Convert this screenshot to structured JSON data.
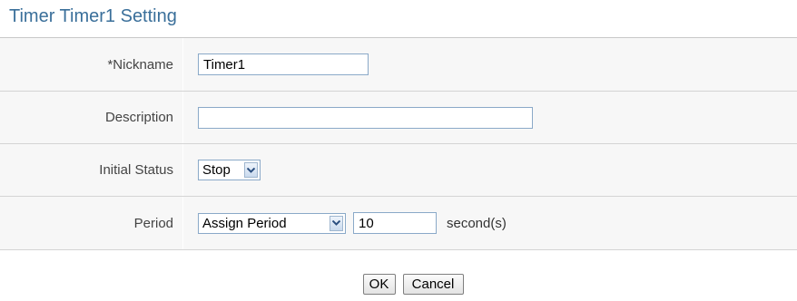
{
  "header": {
    "title": "Timer Timer1 Setting"
  },
  "form": {
    "nickname": {
      "label": "*Nickname",
      "value": "Timer1"
    },
    "description": {
      "label": "Description",
      "value": ""
    },
    "initial_status": {
      "label": "Initial Status",
      "selected": "Stop"
    },
    "period": {
      "label": "Period",
      "mode_selected": "Assign Period",
      "value": "10",
      "unit": "second(s)"
    }
  },
  "buttons": {
    "ok_label": "OK",
    "cancel_label": "Cancel"
  },
  "colors": {
    "title": "#3a6f9a",
    "row_background": "#f7f7f7",
    "border": "#8aa9c8"
  },
  "icons": {
    "dropdown": "chevron-down-icon"
  }
}
